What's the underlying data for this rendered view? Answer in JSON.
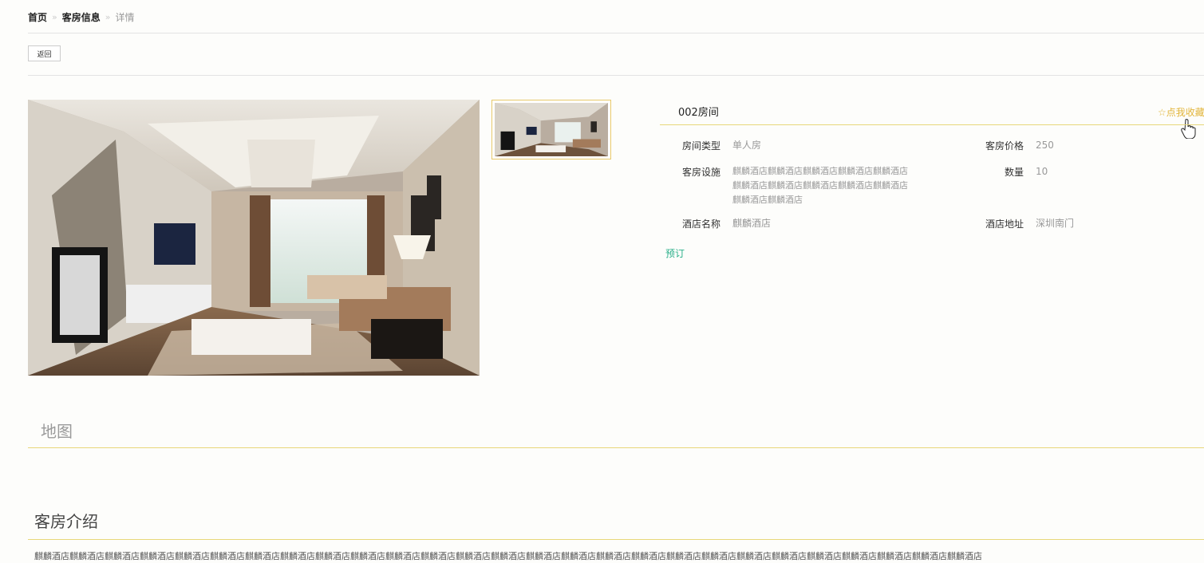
{
  "breadcrumb": {
    "home": "首页",
    "sep1": "»",
    "rooms": "客房信息",
    "sep2": "»",
    "current": "详情"
  },
  "toolbar": {
    "back_label": "返回"
  },
  "room": {
    "title": "002房间",
    "favorite_label": "☆点我收藏",
    "fields": {
      "type_label": "房间类型",
      "type_value": "单人房",
      "price_label": "客房价格",
      "price_value": "250",
      "facilities_label": "客房设施",
      "facilities_value_1": "麒麟酒店麒麟酒店麒麟酒店麒麟酒店麒麟酒店",
      "facilities_value_2": "麒麟酒店麒麟酒店麒麟酒店麒麟酒店麒麟酒店",
      "facilities_value_3": "麒麟酒店麒麟酒店",
      "quantity_label": "数量",
      "quantity_value": "10",
      "hotel_name_label": "酒店名称",
      "hotel_name_value": "麒麟酒店",
      "hotel_address_label": "酒店地址",
      "hotel_address_value": "深圳南门"
    },
    "book_label": "预订"
  },
  "sections": {
    "map_title": "地图",
    "intro_title": "客房介绍",
    "intro_text": "麒麟酒店麒麟酒店麒麟酒店麒麟酒店麒麟酒店麒麟酒店麒麟酒店麒麟酒店麒麟酒店麒麟酒店麒麟酒店麒麟酒店麒麟酒店麒麟酒店麒麟酒店麒麟酒店麒麟酒店麒麟酒店麒麟酒店麒麟酒店麒麟酒店麒麟酒店麒麟酒店麒麟酒店麒麟酒店麒麟酒店麒麟酒店"
  },
  "colors": {
    "accent": "#e8d77a",
    "favorite": "#e2b53a",
    "book": "#2bb08a"
  },
  "icons": {
    "cursor": "hand-pointer-icon",
    "image": "room-photo"
  }
}
